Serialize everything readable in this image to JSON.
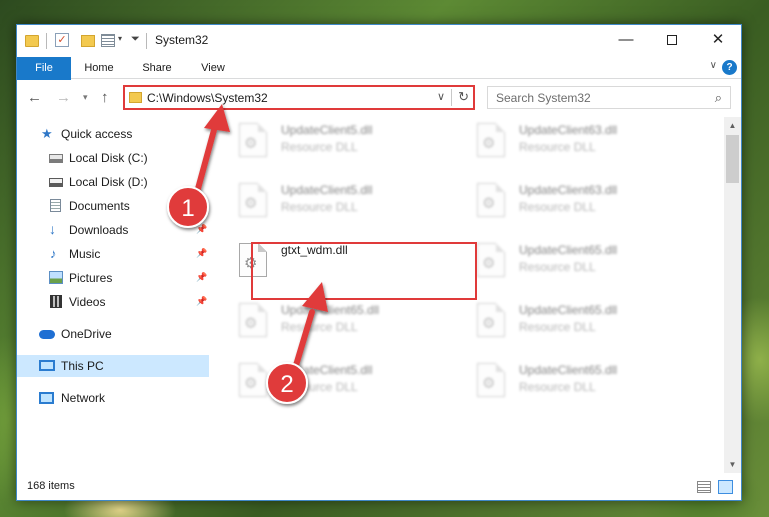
{
  "window": {
    "title": "System32"
  },
  "ribbon": {
    "tabs": [
      {
        "label": "File"
      },
      {
        "label": "Home"
      },
      {
        "label": "Share"
      },
      {
        "label": "View"
      }
    ],
    "help_label": "?"
  },
  "navbar": {
    "address": "C:\\Windows\\System32",
    "search_placeholder": "Search System32"
  },
  "sidebar": {
    "items": [
      {
        "label": "Quick access",
        "icon": "quick-access-star-icon"
      },
      {
        "label": "Local Disk (C:)",
        "icon": "local-disk-icon"
      },
      {
        "label": "Local Disk (D:)",
        "icon": "local-disk-icon"
      },
      {
        "label": "Documents",
        "icon": "documents-icon",
        "pinned": true
      },
      {
        "label": "Downloads",
        "icon": "downloads-icon",
        "pinned": true
      },
      {
        "label": "Music",
        "icon": "music-icon",
        "pinned": true
      },
      {
        "label": "Pictures",
        "icon": "pictures-icon",
        "pinned": true
      },
      {
        "label": "Videos",
        "icon": "videos-icon",
        "pinned": true
      },
      {
        "label": "OneDrive",
        "icon": "onedrive-cloud-icon"
      },
      {
        "label": "This PC",
        "icon": "this-pc-icon",
        "selected": true
      },
      {
        "label": "Network",
        "icon": "network-icon"
      }
    ]
  },
  "files": [
    {
      "name": "UpdateClient5.dll",
      "type": "Resource DLL",
      "blurred": true
    },
    {
      "name": "UpdateClient63.dll",
      "type": "Resource DLL",
      "blurred": true
    },
    {
      "name": "UpdateClient5.dll",
      "type": "Resource DLL",
      "blurred": true
    },
    {
      "name": "UpdateClient63.dll",
      "type": "Resource DLL",
      "blurred": true
    },
    {
      "name": "gtxt_wdm.dll",
      "type": "",
      "blurred": false,
      "highlighted": true
    },
    {
      "name": "UpdateClient65.dll",
      "type": "Resource DLL",
      "blurred": true
    },
    {
      "name": "UpdateClient65.dll",
      "type": "Resource DLL",
      "blurred": true
    },
    {
      "name": "UpdateClient65.dll",
      "type": "Resource DLL",
      "blurred": true
    },
    {
      "name": "UpdateClient5.dll",
      "type": "Resource DLL",
      "blurred": true
    },
    {
      "name": "UpdateClient65.dll",
      "type": "Resource DLL",
      "blurred": true
    }
  ],
  "status": {
    "item_count": "168 items"
  },
  "annotations": {
    "step1": "1",
    "step2": "2",
    "color": "#e03a3a"
  }
}
